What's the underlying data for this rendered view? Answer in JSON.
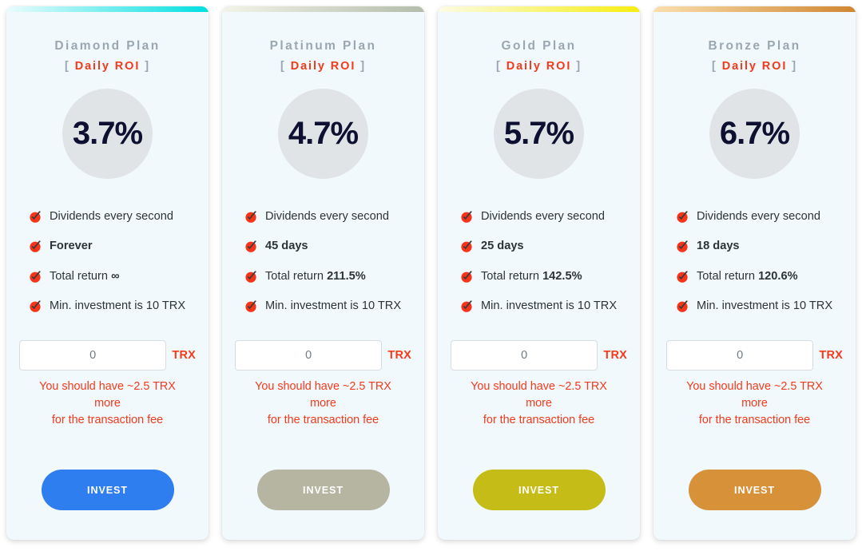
{
  "page": {
    "background": "#ffffff",
    "card_background": "#f1f9fd",
    "accent_red": "#f5391a",
    "title_grey": "#9aa7b0",
    "circle_grey": "#e1e4e6",
    "percent_color": "#0d1030"
  },
  "common": {
    "roi_bracket_open": "[",
    "roi_bracket_close": "]",
    "roi_label": "Daily ROI",
    "input_placeholder": "0",
    "input_value": "0",
    "trx_label": "TRX",
    "warning_line1": "You should have ~2.5 TRX",
    "warning_line2": "more",
    "warning_line3": "for the transaction fee",
    "invest_label": "INVEST",
    "check_icon": "red-check-icon"
  },
  "plans": [
    {
      "id": "diamond",
      "title": "Diamond Plan",
      "percent": "3.7%",
      "bar_from": "#eafcfd",
      "bar_to": "#00dfe0",
      "button_color": "#2f7ef0",
      "features": [
        {
          "prefix": "Dividends every second",
          "bold": "",
          "suffix": "",
          "all_bold": false
        },
        {
          "prefix": "",
          "bold": "Forever",
          "suffix": "",
          "all_bold": true
        },
        {
          "prefix": "Total return ",
          "bold": "∞",
          "suffix": "",
          "all_bold": false
        },
        {
          "prefix": "Min. investment is 10 TRX",
          "bold": "",
          "suffix": "",
          "all_bold": false
        }
      ]
    },
    {
      "id": "platinum",
      "title": "Platinum Plan",
      "percent": "4.7%",
      "bar_from": "#f2f4e8",
      "bar_to": "#b5bcab",
      "button_color": "#b5b5a1",
      "features": [
        {
          "prefix": "Dividends every second",
          "bold": "",
          "suffix": "",
          "all_bold": false
        },
        {
          "prefix": "",
          "bold": "45 days",
          "suffix": "",
          "all_bold": true
        },
        {
          "prefix": "Total return ",
          "bold": "211.5%",
          "suffix": "",
          "all_bold": false
        },
        {
          "prefix": "Min. investment is 10 TRX",
          "bold": "",
          "suffix": "",
          "all_bold": false
        }
      ]
    },
    {
      "id": "gold",
      "title": "Gold Plan",
      "percent": "5.7%",
      "bar_from": "#fbfce6",
      "bar_to": "#f7ee10",
      "button_color": "#c5bc18",
      "features": [
        {
          "prefix": "Dividends every second",
          "bold": "",
          "suffix": "",
          "all_bold": false
        },
        {
          "prefix": "",
          "bold": "25 days",
          "suffix": "",
          "all_bold": true
        },
        {
          "prefix": "Total return ",
          "bold": "142.5%",
          "suffix": "",
          "all_bold": false
        },
        {
          "prefix": "Min. investment is 10 TRX",
          "bold": "",
          "suffix": "",
          "all_bold": false
        }
      ]
    },
    {
      "id": "bronze",
      "title": "Bronze Plan",
      "percent": "6.7%",
      "bar_from": "#fbdfae",
      "bar_to": "#d08631",
      "button_color": "#d79139",
      "features": [
        {
          "prefix": "Dividends every second",
          "bold": "",
          "suffix": "",
          "all_bold": false
        },
        {
          "prefix": "",
          "bold": "18 days",
          "suffix": "",
          "all_bold": true
        },
        {
          "prefix": "Total return ",
          "bold": "120.6%",
          "suffix": "",
          "all_bold": false
        },
        {
          "prefix": "Min. investment is 10 TRX",
          "bold": "",
          "suffix": "",
          "all_bold": false
        }
      ]
    }
  ]
}
